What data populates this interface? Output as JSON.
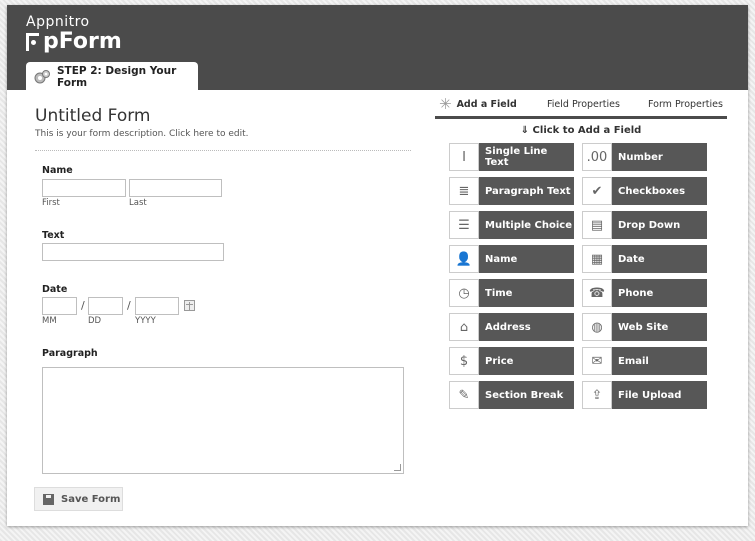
{
  "brand": {
    "top": "Appnitro",
    "main": "pForm"
  },
  "step_tab": {
    "label": "STEP 2: Design Your Form"
  },
  "form": {
    "title": "Untitled Form",
    "description": "This is your form description. Click here to edit.",
    "fields": {
      "name": {
        "label": "Name",
        "first": "First",
        "last": "Last"
      },
      "text": {
        "label": "Text"
      },
      "date": {
        "label": "Date",
        "mm": "MM",
        "dd": "DD",
        "yyyy": "YYYY",
        "sep": "/"
      },
      "paragraph": {
        "label": "Paragraph"
      }
    },
    "save_label": "Save Form"
  },
  "panel": {
    "tabs": [
      "Add a Field",
      "Field Properties",
      "Form Properties"
    ],
    "hint": "Click to Add a Field",
    "left": [
      {
        "label": "Single Line Text",
        "icon": "single-line-text-icon",
        "glyph": "I"
      },
      {
        "label": "Paragraph Text",
        "icon": "paragraph-text-icon",
        "glyph": "≣"
      },
      {
        "label": "Multiple Choice",
        "icon": "multiple-choice-icon",
        "glyph": "☰"
      },
      {
        "label": "Name",
        "icon": "person-icon",
        "glyph": "👤"
      },
      {
        "label": "Time",
        "icon": "clock-icon",
        "glyph": "◷"
      },
      {
        "label": "Address",
        "icon": "house-icon",
        "glyph": "⌂"
      },
      {
        "label": "Price",
        "icon": "dollar-icon",
        "glyph": "$"
      },
      {
        "label": "Section Break",
        "icon": "pencil-icon",
        "glyph": "✎"
      }
    ],
    "right": [
      {
        "label": "Number",
        "icon": "number-icon",
        "glyph": ".00"
      },
      {
        "label": "Checkboxes",
        "icon": "checkmark-icon",
        "glyph": "✔"
      },
      {
        "label": "Drop Down",
        "icon": "dropdown-icon",
        "glyph": "▤"
      },
      {
        "label": "Date",
        "icon": "calendar-icon",
        "glyph": "▦"
      },
      {
        "label": "Phone",
        "icon": "phone-icon",
        "glyph": "☎"
      },
      {
        "label": "Web Site",
        "icon": "globe-icon",
        "glyph": "◍"
      },
      {
        "label": "Email",
        "icon": "envelope-icon",
        "glyph": "✉"
      },
      {
        "label": "File Upload",
        "icon": "file-upload-icon",
        "glyph": "⇪"
      }
    ]
  },
  "colors": {
    "header": "#4b4b4b",
    "button": "#575757"
  }
}
